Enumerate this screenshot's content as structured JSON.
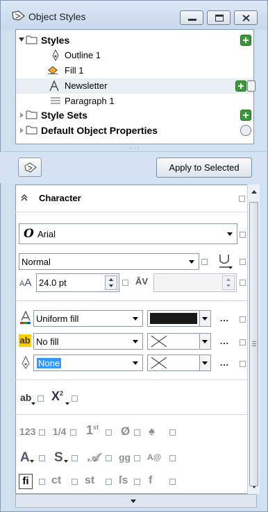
{
  "window": {
    "title": "Object Styles",
    "accent": "#3a9a3a"
  },
  "tree": {
    "styles_label": "Styles",
    "items": [
      {
        "label": "Outline 1",
        "icon": "pen-nib-icon"
      },
      {
        "label": "Fill 1",
        "icon": "paint-bucket-icon"
      },
      {
        "label": "Newsletter",
        "icon": "character-style-icon"
      },
      {
        "label": "Paragraph 1",
        "icon": "paragraph-style-icon"
      }
    ],
    "style_sets_label": "Style Sets",
    "defaults_label": "Default Object Properties"
  },
  "toolbar": {
    "apply_label": "Apply to Selected"
  },
  "character": {
    "section_label": "Character",
    "font_name": "Arial",
    "font_style": "Normal",
    "font_size": "24.0 pt",
    "kerning_value": "",
    "fill_type": "Uniform fill",
    "fill_color": "#1a1a1a",
    "bg_fill_type": "No fill",
    "outline_type": "None",
    "ellipsis": "..."
  }
}
